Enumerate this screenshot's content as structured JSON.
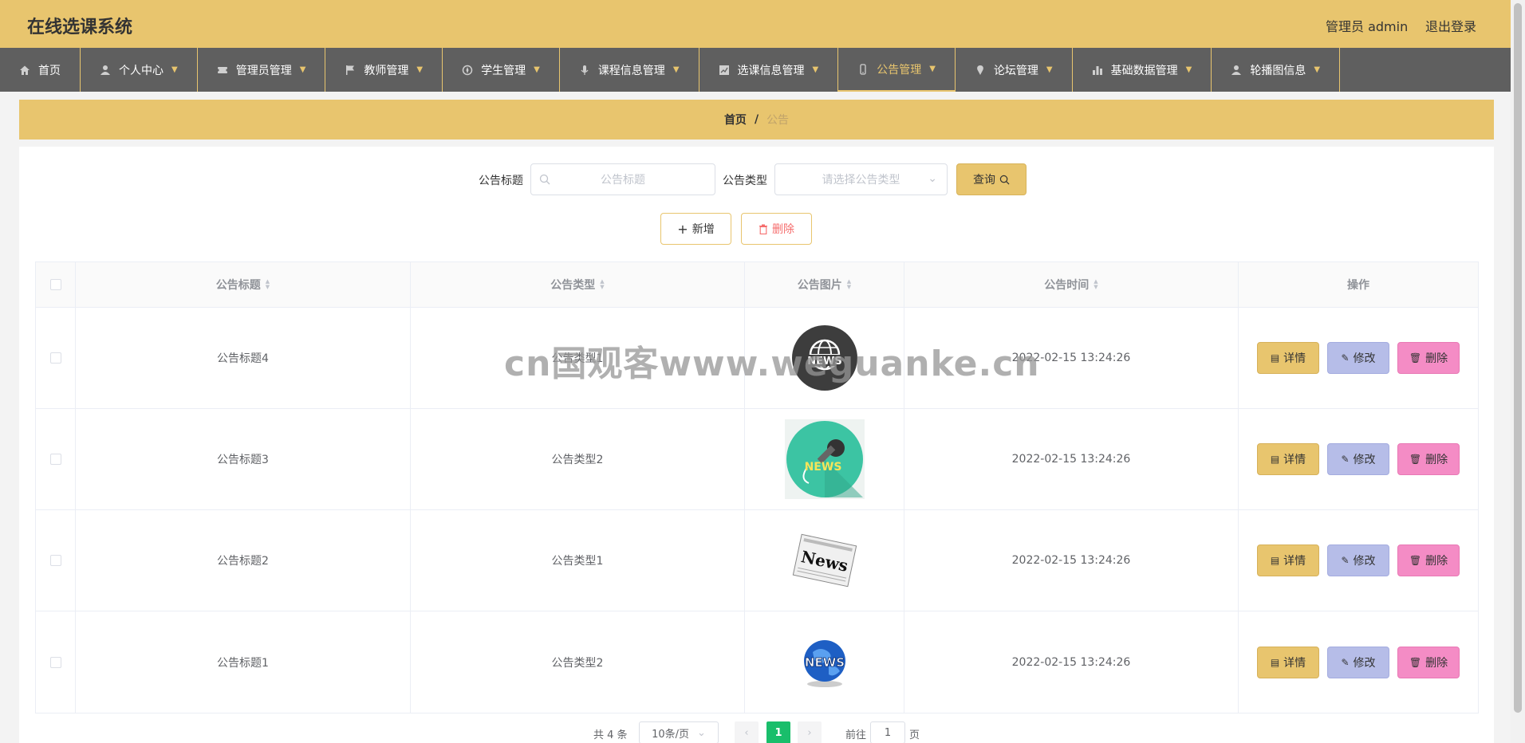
{
  "header": {
    "title": "在线选课系统",
    "user": "管理员 admin",
    "logout": "退出登录"
  },
  "nav": [
    {
      "label": "首页",
      "icon": "home-icon"
    },
    {
      "label": "个人中心",
      "icon": "user-icon"
    },
    {
      "label": "管理员管理",
      "icon": "ticket-icon"
    },
    {
      "label": "教师管理",
      "icon": "flag-icon"
    },
    {
      "label": "学生管理",
      "icon": "compass-icon"
    },
    {
      "label": "课程信息管理",
      "icon": "microphone-icon"
    },
    {
      "label": "选课信息管理",
      "icon": "chart-icon"
    },
    {
      "label": "公告管理",
      "icon": "phone-icon"
    },
    {
      "label": "论坛管理",
      "icon": "location-icon"
    },
    {
      "label": "基础数据管理",
      "icon": "bar-chart-icon"
    },
    {
      "label": "轮播图信息",
      "icon": "user-icon"
    }
  ],
  "breadcrumb": {
    "home": "首页",
    "sep": "/",
    "current": "公告"
  },
  "search": {
    "title_label": "公告标题",
    "title_placeholder": "公告标题",
    "type_label": "公告类型",
    "type_placeholder": "请选择公告类型",
    "query": "查询"
  },
  "actions": {
    "add": "新增",
    "delete": "删除"
  },
  "table": {
    "headers": [
      "公告标题",
      "公告类型",
      "公告图片",
      "公告时间",
      "操作"
    ],
    "rows": [
      {
        "title": "公告标题4",
        "type": "公告类型1",
        "image": "news-globe-dark",
        "time": "2022-02-15 13:24:26"
      },
      {
        "title": "公告标题3",
        "type": "公告类型2",
        "image": "news-mic-teal",
        "time": "2022-02-15 13:24:26"
      },
      {
        "title": "公告标题2",
        "type": "公告类型1",
        "image": "news-paper",
        "time": "2022-02-15 13:24:26"
      },
      {
        "title": "公告标题1",
        "type": "公告类型2",
        "image": "news-globe-blue",
        "time": "2022-02-15 13:24:26"
      }
    ],
    "btn_detail": "详情",
    "btn_edit": "修改",
    "btn_delete": "删除"
  },
  "pager": {
    "total": "共 4 条",
    "size": "10条/页",
    "current": "1",
    "goto": "前往",
    "goto_value": "1",
    "page": "页"
  },
  "watermark": "cn国观客www.weguanke.cn",
  "colors": {
    "accent": "#e8c56e",
    "nav": "#5f5f5f",
    "edit": "#b6bde8",
    "delete": "#f48cc5",
    "pager_active": "#19be6b"
  }
}
